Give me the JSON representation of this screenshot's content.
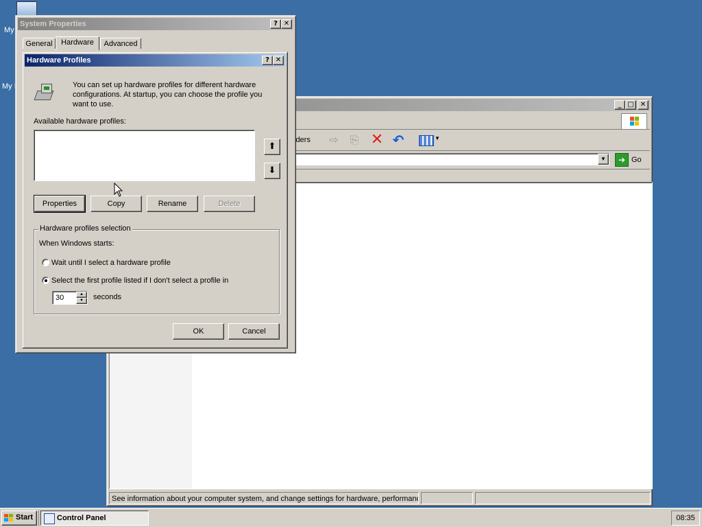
{
  "desktop": {
    "icon1_label": "My",
    "icon2_label": "My I"
  },
  "control_panel": {
    "toolbar_folders_label": "lders",
    "go_label": "Go",
    "status_text": "See information about your computer system, and change settings for hardware, performanc"
  },
  "system_properties": {
    "title": "System Properties",
    "help_btn": "?",
    "close_btn": "✕",
    "tabs": [
      {
        "label": "General"
      },
      {
        "label": "Hardware"
      },
      {
        "label": "Advanced"
      }
    ]
  },
  "hardware_profiles": {
    "title": "Hardware Profiles",
    "help_btn": "?",
    "close_btn": "✕",
    "intro": "You can set up hardware profiles for different hardware configurations.  At startup, you can choose the profile you want to use.",
    "available_label": "Available hardware profiles:",
    "up_arrow": "⬆",
    "down_arrow": "⬇",
    "buttons": {
      "properties": "Properties",
      "copy": "Copy",
      "rename": "Rename",
      "delete": "Delete"
    },
    "selection_group": "Hardware profiles selection",
    "when_starts": "When Windows starts:",
    "option_wait": "Wait until I select a hardware profile",
    "option_first": "Select the first profile listed if I don't select a profile in",
    "seconds_value": "30",
    "seconds_label": "seconds",
    "ok": "OK",
    "cancel": "Cancel"
  },
  "taskbar": {
    "start_label": "Start",
    "task_label": "Control Panel",
    "clock": "08:35"
  },
  "icons": {
    "hardware_profile": "computer-profile-icon",
    "go": "go-arrow-icon",
    "delete": "delete-x-icon",
    "undo": "undo-icon",
    "views": "views-icon"
  }
}
